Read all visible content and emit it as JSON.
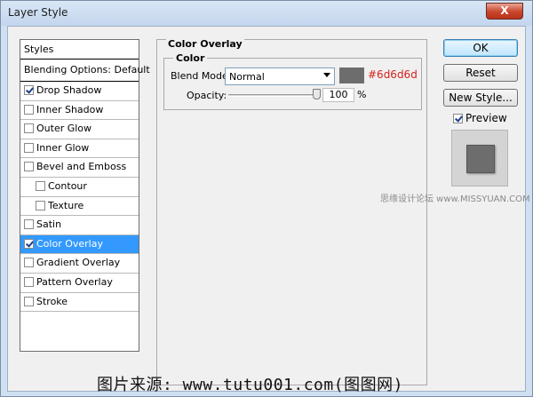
{
  "window": {
    "title": "Layer Style",
    "close_label": "X"
  },
  "styles_panel": {
    "header": "Styles",
    "items": [
      {
        "label": "Blending Options: Default",
        "checkbox": false,
        "checked": false,
        "indent": false,
        "selected": false
      },
      {
        "label": "Drop Shadow",
        "checkbox": true,
        "checked": true,
        "indent": false,
        "selected": false
      },
      {
        "label": "Inner Shadow",
        "checkbox": true,
        "checked": false,
        "indent": false,
        "selected": false
      },
      {
        "label": "Outer Glow",
        "checkbox": true,
        "checked": false,
        "indent": false,
        "selected": false
      },
      {
        "label": "Inner Glow",
        "checkbox": true,
        "checked": false,
        "indent": false,
        "selected": false
      },
      {
        "label": "Bevel and Emboss",
        "checkbox": true,
        "checked": false,
        "indent": false,
        "selected": false
      },
      {
        "label": "Contour",
        "checkbox": true,
        "checked": false,
        "indent": true,
        "selected": false
      },
      {
        "label": "Texture",
        "checkbox": true,
        "checked": false,
        "indent": true,
        "selected": false
      },
      {
        "label": "Satin",
        "checkbox": true,
        "checked": false,
        "indent": false,
        "selected": false
      },
      {
        "label": "Color Overlay",
        "checkbox": true,
        "checked": true,
        "indent": false,
        "selected": true
      },
      {
        "label": "Gradient Overlay",
        "checkbox": true,
        "checked": false,
        "indent": false,
        "selected": false
      },
      {
        "label": "Pattern Overlay",
        "checkbox": true,
        "checked": false,
        "indent": false,
        "selected": false
      },
      {
        "label": "Stroke",
        "checkbox": true,
        "checked": false,
        "indent": false,
        "selected": false
      }
    ]
  },
  "color_overlay": {
    "title": "Color Overlay",
    "group_title": "Color",
    "blend_mode_label": "Blend Mode:",
    "blend_mode_value": "Normal",
    "swatch_color": "#6d6d6d",
    "swatch_text": "#6d6d6d",
    "opacity_label": "Opacity:",
    "opacity_value": "100",
    "opacity_unit": "%",
    "opacity_fraction": 1.0
  },
  "buttons": {
    "ok": "OK",
    "reset": "Reset",
    "new_style": "New Style...",
    "preview_label": "Preview",
    "preview_checked": true
  },
  "preview": {
    "fill_color": "#6d6d6d"
  },
  "watermarks": {
    "top": "思缘设计论坛 www.MISSYUAN.COM",
    "bottom": "图片来源: www.tutu001.com(图图网)"
  }
}
